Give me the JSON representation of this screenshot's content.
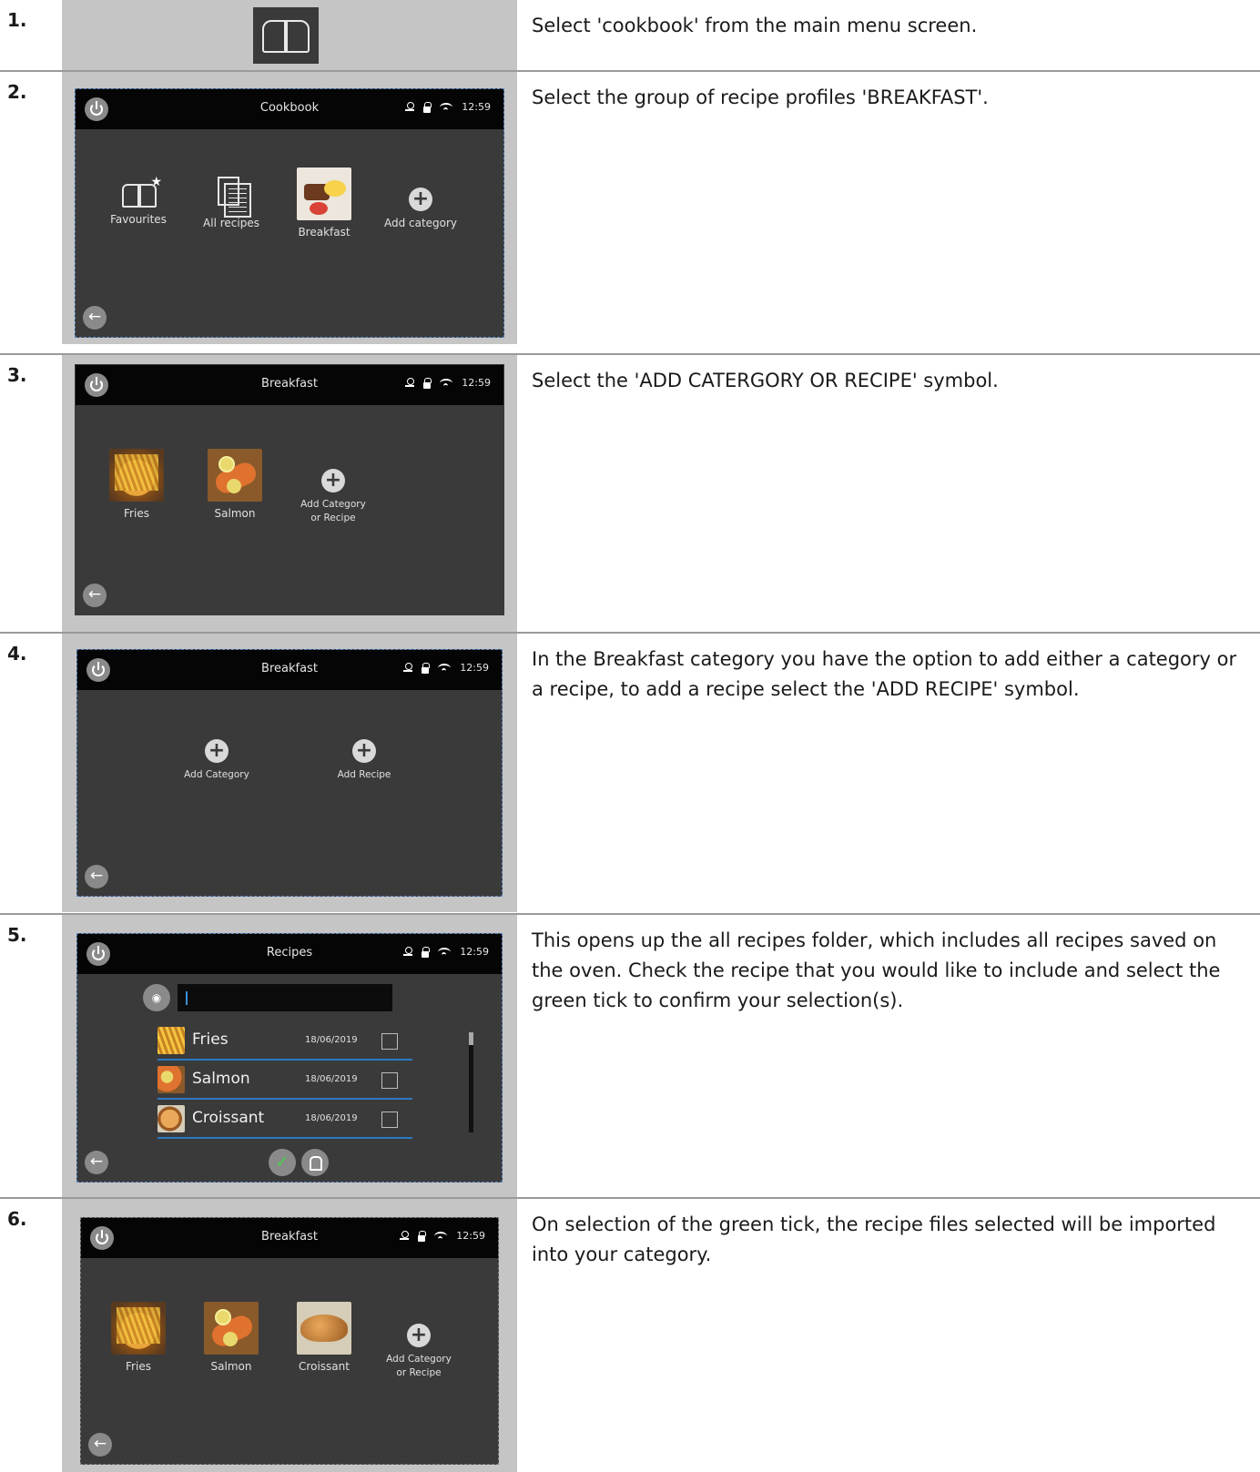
{
  "steps": [
    {
      "number": "1.",
      "text": "Select 'cookbook' from the main menu screen."
    },
    {
      "number": "2.",
      "text": "Select the group of recipe profiles 'BREAKFAST'."
    },
    {
      "number": "3.",
      "text": "Select the 'ADD CATERGORY OR RECIPE' symbol."
    },
    {
      "number": "4.",
      "text": "In the Breakfast category you have the option to add either a category or a recipe, to add a recipe select the 'ADD RECIPE' symbol."
    },
    {
      "number": "5.",
      "text": "This opens up the all recipes folder, which includes all recipes saved on the oven. Check the recipe that you would like to include and select the green tick to confirm your selection(s)."
    },
    {
      "number": "6.",
      "text": "On selection of the green tick, the recipe files selected will be imported into your category."
    }
  ],
  "status": {
    "time": "12:59"
  },
  "screens": {
    "cookbook": {
      "title": "Cookbook",
      "tiles": [
        "Favourites",
        "All recipes",
        "Breakfast",
        "Add category"
      ]
    },
    "breakfast": {
      "title": "Breakfast",
      "tiles": [
        "Fries",
        "Salmon"
      ],
      "add_label_1": "Add Category",
      "add_label_2": "or Recipe"
    },
    "breakfast_add": {
      "title": "Breakfast",
      "add_category": "Add Category",
      "add_recipe": "Add Recipe"
    },
    "recipes": {
      "title": "Recipes",
      "search_value": "",
      "items": [
        {
          "name": "Fries",
          "date": "18/06/2019",
          "checked": false
        },
        {
          "name": "Salmon",
          "date": "18/06/2019",
          "checked": false
        },
        {
          "name": "Croissant",
          "date": "18/06/2019",
          "checked": false
        }
      ]
    },
    "breakfast_result": {
      "title": "Breakfast",
      "tiles": [
        "Fries",
        "Salmon",
        "Croissant"
      ],
      "add_label_1": "Add Category",
      "add_label_2": "or Recipe"
    }
  }
}
